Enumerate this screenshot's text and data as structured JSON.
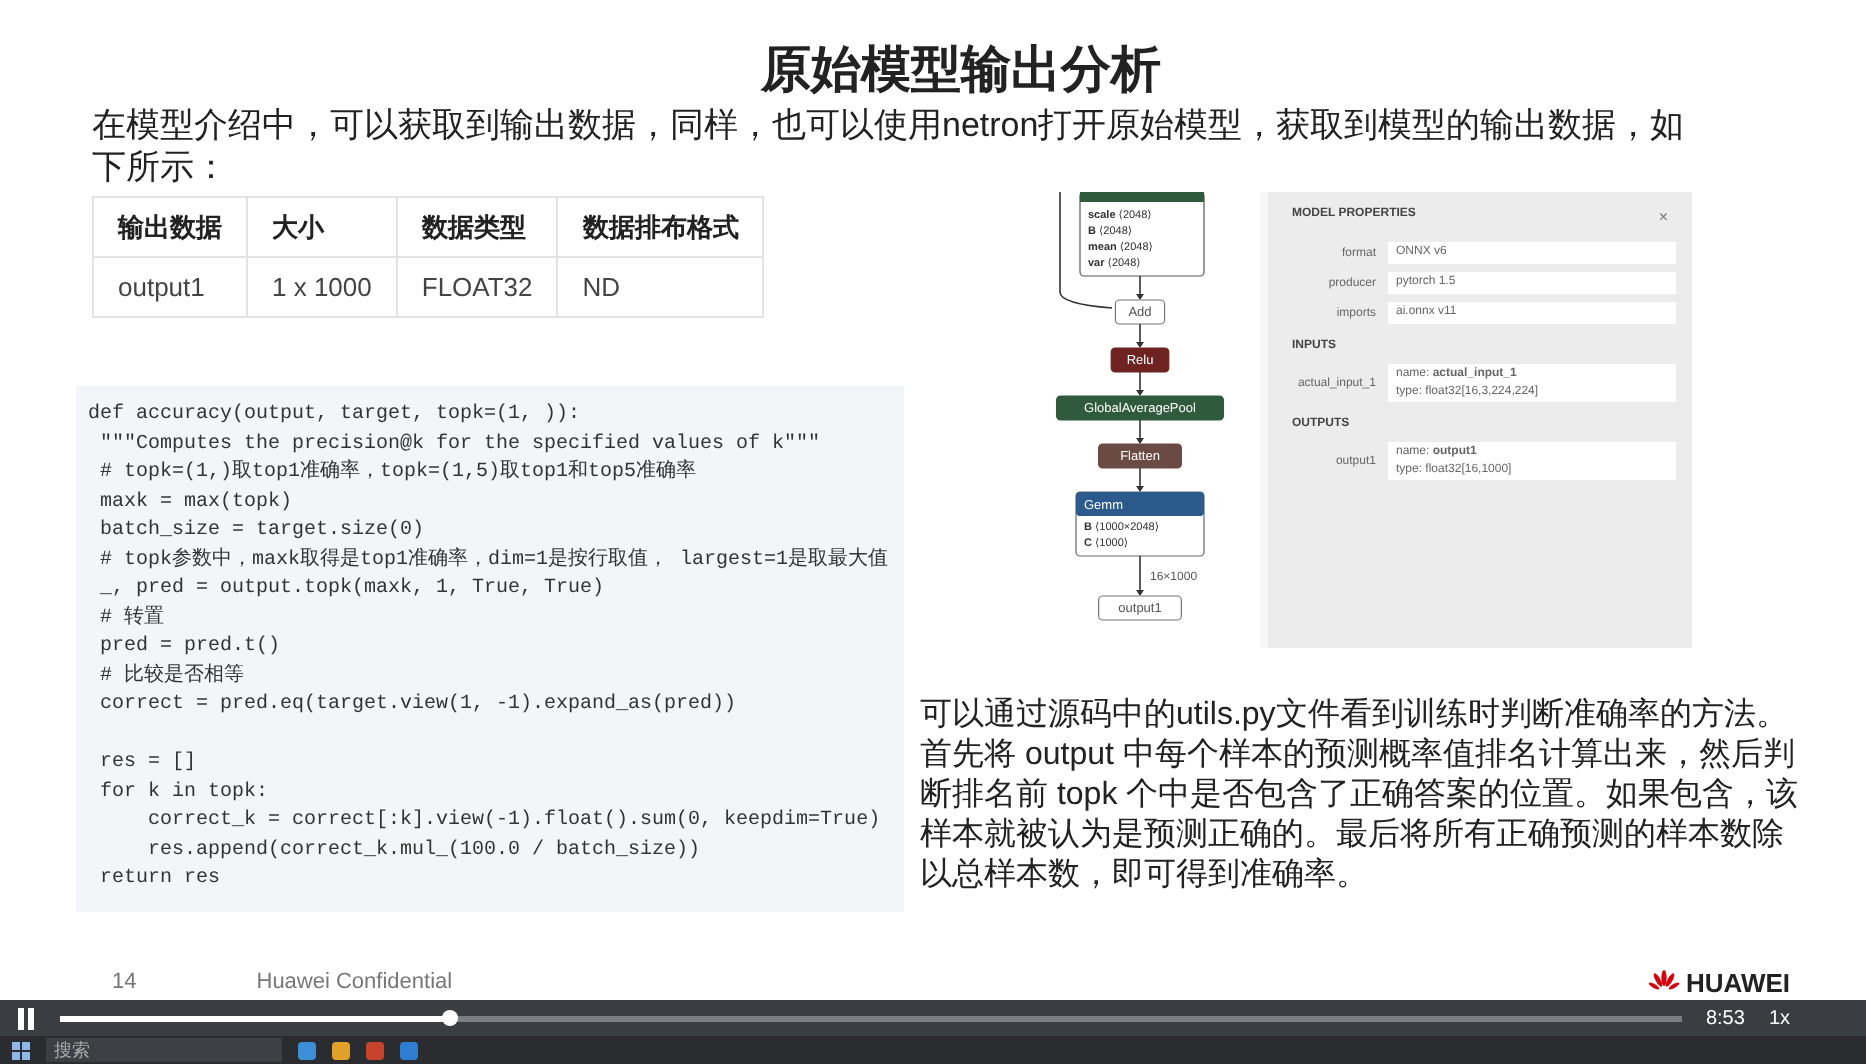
{
  "slide": {
    "title": "原始模型输出分析",
    "intro": "在模型介绍中，可以获取到输出数据，同样，也可以使用netron打开原始模型，获取到模型的输出数据，如下所示：",
    "table": {
      "columns": [
        "输出数据",
        "大小",
        "数据类型",
        "数据排布格式"
      ],
      "rows": [
        [
          "output1",
          "1 x 1000",
          "FLOAT32",
          "ND"
        ]
      ]
    },
    "code_blocks": [
      [
        "def accuracy(output, target, topk=(1, )):",
        " \"\"\"Computes the precision@k for the specified values of k\"\"\"",
        " # topk=(1,)取top1准确率，topk=(1,5)取top1和top5准确率",
        " maxk = max(topk)",
        " batch_size = target.size(0)",
        " # topk参数中，maxk取得是top1准确率，dim=1是按行取值， largest=1是取最大值",
        " _, pred = output.topk(maxk, 1, True, True)",
        " # 转置",
        " pred = pred.t()",
        " # 比较是否相等",
        " correct = pred.eq(target.view(1, -1).expand_as(pred))"
      ],
      [
        " res = []",
        " for k in topk:",
        "     correct_k = correct[:k].view(-1).float().sum(0, keepdim=True)",
        "     res.append(correct_k.mul_(100.0 / batch_size))",
        " return res"
      ]
    ],
    "netron_graph": {
      "nodes": [
        {
          "kind": "cut",
          "color": "#2f5b3c",
          "attributes": [
            {
              "name": "scale",
              "value": "⟨2048⟩"
            },
            {
              "name": "B",
              "value": "⟨2048⟩"
            },
            {
              "name": "mean",
              "value": "⟨2048⟩"
            },
            {
              "name": "var",
              "value": "⟨2048⟩"
            }
          ]
        },
        {
          "kind": "plain",
          "label": "Add"
        },
        {
          "kind": "op",
          "label": "Relu",
          "color": "#6e2222"
        },
        {
          "kind": "op",
          "label": "GlobalAveragePool",
          "color": "#2f5b3c"
        },
        {
          "kind": "op",
          "label": "Flatten",
          "color": "#6b4a44"
        },
        {
          "kind": "attributes",
          "label": "Gemm",
          "color": "#2c5a8c",
          "attributes": [
            {
              "name": "B",
              "value": "⟨1000×2048⟩"
            },
            {
              "name": "C",
              "value": "⟨1000⟩"
            }
          ]
        },
        {
          "kind": "output",
          "label": "output1",
          "edge_label": "16×1000"
        }
      ]
    },
    "model_properties": {
      "title": "MODEL PROPERTIES",
      "close": "×",
      "fields": [
        {
          "label": "format",
          "value": "ONNX v6"
        },
        {
          "label": "producer",
          "value": "pytorch 1.5"
        },
        {
          "label": "imports",
          "value": "ai.onnx v11"
        }
      ],
      "sections": [
        {
          "heading": "INPUTS",
          "items": [
            {
              "label": "actual_input_1",
              "name": "name: **actual_input_1**",
              "type": "type: float32[16,3,224,224]"
            }
          ]
        },
        {
          "heading": "OUTPUTS",
          "items": [
            {
              "label": "output1",
              "name": "name: **output1**",
              "type": "type: float32[16,1000]"
            }
          ]
        }
      ]
    },
    "explanation": [
      "可以通过源码中的utils.py文件看到训练时判断准确率的方法。",
      "首先将 output 中每个样本的预测概率值排名计算出来，然后判断排名前 topk 个中是否包含了正确答案的位置。如果包含，该样本就被认为是预测正确的。最后将所有正确预测的样本数除以总样本数，即可得到准确率。"
    ],
    "footer": {
      "page": "14",
      "confidential": "Huawei Confidential",
      "logo": "HUAWEI"
    }
  },
  "player": {
    "playing": true,
    "level": 0.24,
    "time": "8:53",
    "speed": "1x"
  },
  "taskbar": {
    "search": {
      "placeholder": "搜索"
    }
  }
}
